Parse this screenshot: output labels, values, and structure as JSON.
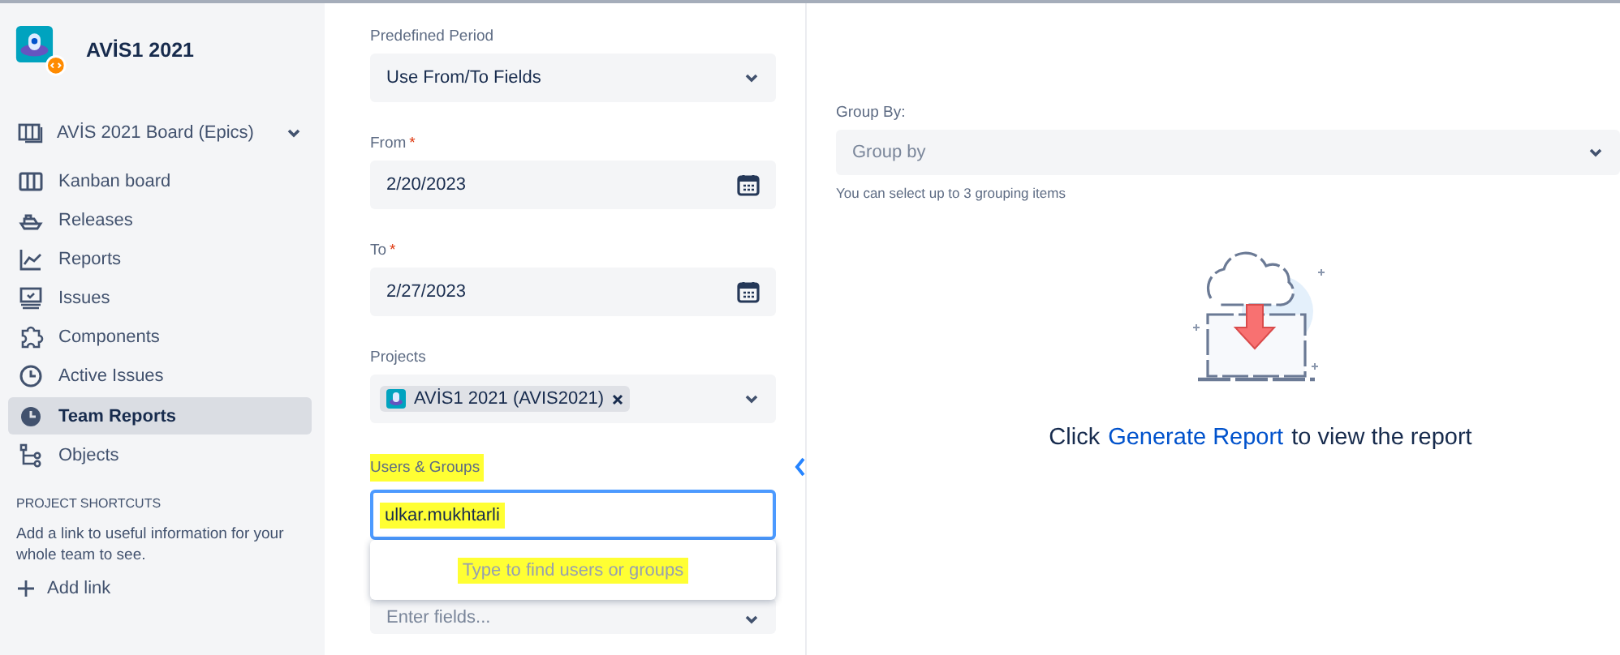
{
  "project": {
    "name": "AVİS1 2021"
  },
  "sidebar": {
    "board": {
      "label": "AVİS 2021 Board (Epics)",
      "expanded": false
    },
    "items": [
      {
        "label": "Kanban board",
        "kind": "columns",
        "selected": false
      },
      {
        "label": "Releases",
        "kind": "ship",
        "selected": false
      },
      {
        "label": "Reports",
        "kind": "chart",
        "selected": false
      },
      {
        "label": "Issues",
        "kind": "monitor",
        "selected": false
      },
      {
        "label": "Components",
        "kind": "puzzle",
        "selected": false
      },
      {
        "label": "Active Issues",
        "kind": "clock",
        "selected": false
      },
      {
        "label": "Team Reports",
        "kind": "history",
        "selected": true
      },
      {
        "label": "Objects",
        "kind": "tree",
        "selected": false
      }
    ],
    "shortcuts": {
      "heading": "PROJECT SHORTCUTS",
      "text": "Add a link to useful information for your whole team to see.",
      "add_link": "Add link"
    }
  },
  "form": {
    "predefined_period": {
      "label": "Predefined Period",
      "value": "Use From/To Fields"
    },
    "dates": [
      {
        "label": "From",
        "required_mark": "*",
        "value": "2/20/2023"
      },
      {
        "label": "To",
        "required_mark": "*",
        "value": "2/27/2023"
      }
    ],
    "projects": {
      "label": "Projects",
      "tags": [
        {
          "label": "AVİS1 2021 (AVIS2021)"
        }
      ]
    },
    "users_groups": {
      "label": "Users & Groups",
      "value": "ulkar.mukhtarli",
      "focused": true,
      "highlighted": true,
      "suggestions_hint": "Type to find users or groups"
    },
    "fields": {
      "placeholder": "Enter fields..."
    }
  },
  "group_by": {
    "label": "Group By:",
    "placeholder": "Group by",
    "hint": "You can select up to 3 grouping items"
  },
  "empty_state": {
    "before": "Click",
    "link": "Generate Report",
    "after": "to view the report"
  }
}
